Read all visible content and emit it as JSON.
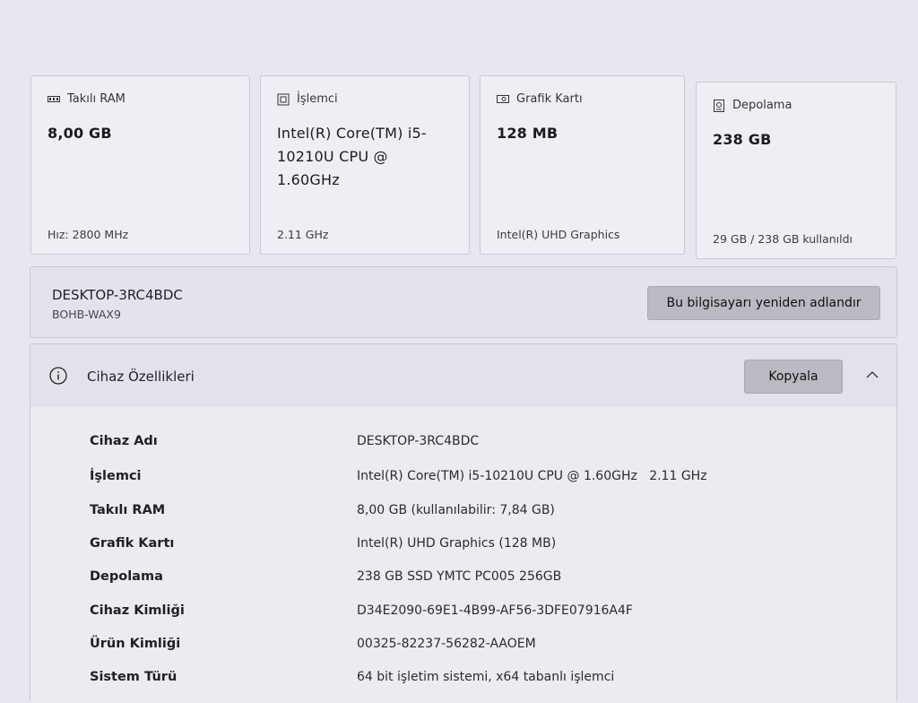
{
  "cards": [
    {
      "label": "Takılı RAM",
      "value": "8,00 GB",
      "foot": "Hız: 2800 MHz",
      "icon": "ram-icon"
    },
    {
      "label": "İşlemci",
      "value": "Intel(R) Core(TM) i5-10210U CPU @ 1.60GHz",
      "foot": "2.11 GHz",
      "icon": "processor-icon"
    },
    {
      "label": "Grafik Kartı",
      "value": "128 MB",
      "foot": "Intel(R) UHD Graphics",
      "icon": "graphics-card-icon"
    },
    {
      "label": "Depolama",
      "value": "238 GB",
      "foot": "29 GB / 238 GB kullanıldı",
      "icon": "storage-icon"
    }
  ],
  "device": {
    "name": "DESKTOP-3RC4BDC",
    "sub": "BOHB-WAX9",
    "rename_label": "Bu bilgisayarı yeniden adlandır"
  },
  "specs": {
    "title": "Cihaz Özellikleri",
    "copy_label": "Kopyala",
    "rows": [
      {
        "label": "Cihaz Adı",
        "value": "DESKTOP-3RC4BDC"
      },
      {
        "label": "İşlemci",
        "value": "Intel(R) Core(TM) i5-10210U CPU @ 1.60GHz   2.11 GHz"
      },
      {
        "label": "Takılı RAM",
        "value": "8,00 GB (kullanılabilir: 7,84 GB)"
      },
      {
        "label": "Grafik Kartı",
        "value": "Intel(R) UHD Graphics (128 MB)"
      },
      {
        "label": "Depolama",
        "value": "238 GB SSD YMTC PC005 256GB"
      },
      {
        "label": "Cihaz Kimliği",
        "value": "D34E2090-69E1-4B99-AF56-3DFE07916A4F"
      },
      {
        "label": "Ürün Kimliği",
        "value": "00325-82237-56282-AAOEM"
      },
      {
        "label": "Sistem Türü",
        "value": "64 bit işletim sistemi, x64 tabanlı işlemci"
      }
    ]
  }
}
